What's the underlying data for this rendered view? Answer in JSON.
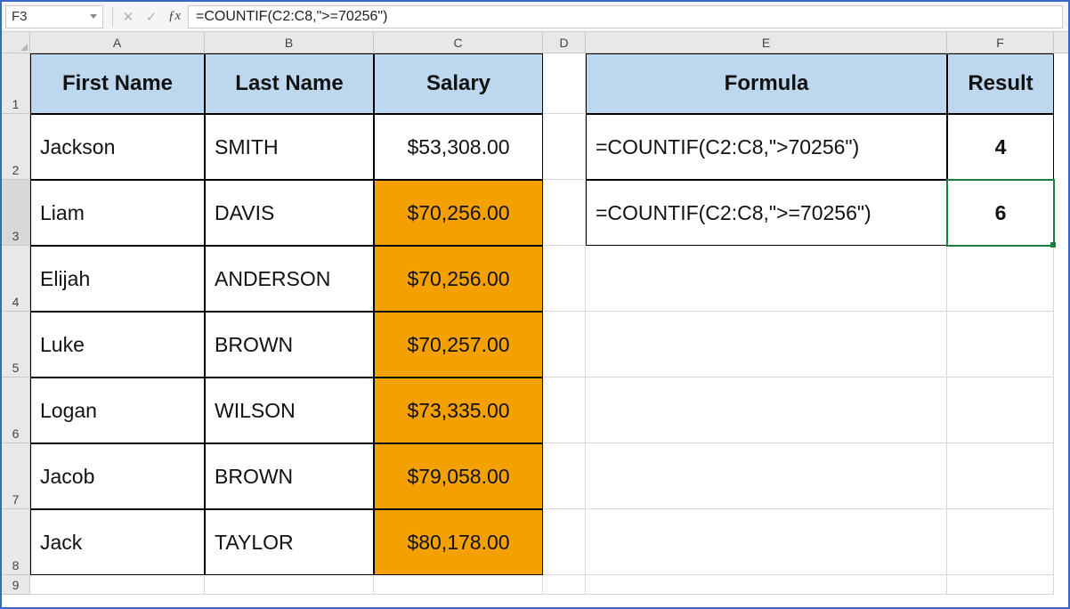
{
  "active_cell_ref": "F3",
  "formula_bar_value": "=COUNTIF(C2:C8,\">=70256\")",
  "column_letters": [
    "A",
    "B",
    "C",
    "D",
    "E",
    "F"
  ],
  "row_numbers": [
    "1",
    "2",
    "3",
    "4",
    "5",
    "6",
    "7",
    "8",
    "9"
  ],
  "headers": {
    "first_name": "First Name",
    "last_name": "Last Name",
    "salary": "Salary",
    "formula": "Formula",
    "result": "Result"
  },
  "people": [
    {
      "first": "Jackson",
      "last": "SMITH",
      "salary": "$53,308.00",
      "hl": false
    },
    {
      "first": "Liam",
      "last": "DAVIS",
      "salary": "$70,256.00",
      "hl": true
    },
    {
      "first": "Elijah",
      "last": "ANDERSON",
      "salary": "$70,256.00",
      "hl": true
    },
    {
      "first": "Luke",
      "last": "BROWN",
      "salary": "$70,257.00",
      "hl": true
    },
    {
      "first": "Logan",
      "last": "WILSON",
      "salary": "$73,335.00",
      "hl": true
    },
    {
      "first": "Jacob",
      "last": "BROWN",
      "salary": "$79,058.00",
      "hl": true
    },
    {
      "first": "Jack",
      "last": "TAYLOR",
      "salary": "$80,178.00",
      "hl": true
    }
  ],
  "formulas": [
    {
      "text": "=COUNTIF(C2:C8,\">70256\")",
      "result": "4"
    },
    {
      "text": "=COUNTIF(C2:C8,\">=70256\")",
      "result": "6"
    }
  ],
  "colors": {
    "header_fill": "#bdd7ee",
    "highlight_fill": "#f4a100",
    "selection": "#1a7f3c",
    "frame_border": "#3a66c4"
  },
  "chart_data": {
    "type": "table",
    "columns": [
      "First Name",
      "Last Name",
      "Salary"
    ],
    "rows": [
      [
        "Jackson",
        "SMITH",
        53308.0
      ],
      [
        "Liam",
        "DAVIS",
        70256.0
      ],
      [
        "Elijah",
        "ANDERSON",
        70256.0
      ],
      [
        "Luke",
        "BROWN",
        70257.0
      ],
      [
        "Logan",
        "WILSON",
        73335.0
      ],
      [
        "Jacob",
        "BROWN",
        79058.0
      ],
      [
        "Jack",
        "TAYLOR",
        80178.0
      ]
    ],
    "side_table": {
      "columns": [
        "Formula",
        "Result"
      ],
      "rows": [
        [
          "=COUNTIF(C2:C8,\">70256\")",
          4
        ],
        [
          "=COUNTIF(C2:C8,\">=70256\")",
          6
        ]
      ]
    }
  }
}
